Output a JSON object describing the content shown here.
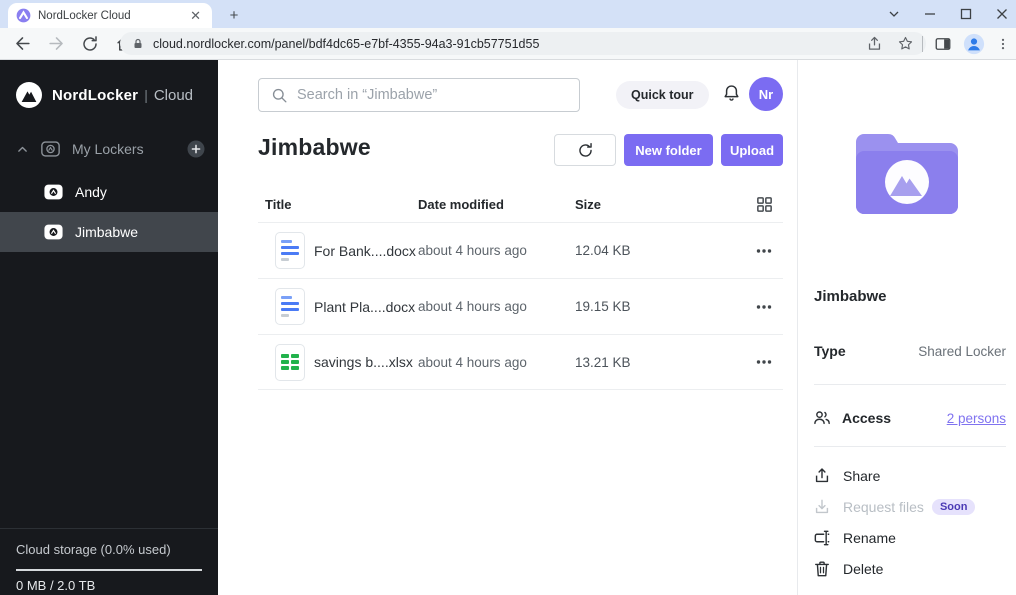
{
  "browser": {
    "tab_title": "NordLocker Cloud",
    "url": "cloud.nordlocker.com/panel/bdf4dc65-e7bf-4355-94a3-91cb57751d55"
  },
  "sidebar": {
    "brand": "NordLocker",
    "brand_divider": "|",
    "brand_suffix": "Cloud",
    "my_lockers_label": "My Lockers",
    "lockers": [
      {
        "name": "Andy"
      },
      {
        "name": "Jimbabwe"
      }
    ],
    "storage_label": "Cloud storage (0.0% used)",
    "storage_usage": "0 MB / 2.0 TB"
  },
  "header": {
    "search_placeholder": "Search in “Jimbabwe”",
    "quick_tour": "Quick tour",
    "avatar_initials": "Nr"
  },
  "content": {
    "title": "Jimbabwe",
    "new_folder": "New folder",
    "upload": "Upload",
    "columns": {
      "title": "Title",
      "date": "Date modified",
      "size": "Size"
    },
    "files": [
      {
        "name": "For Bank....docx",
        "type": "docx",
        "date": "about 4 hours ago",
        "size": "12.04 KB"
      },
      {
        "name": "Plant Pla....docx",
        "type": "docx",
        "date": "about 4 hours ago",
        "size": "19.15 KB"
      },
      {
        "name": "savings b....xlsx",
        "type": "xlsx",
        "date": "about 4 hours ago",
        "size": "13.21 KB"
      }
    ]
  },
  "details": {
    "name": "Jimbabwe",
    "type_label": "Type",
    "type_value": "Shared Locker",
    "access_label": "Access",
    "access_link": "2 persons",
    "share": "Share",
    "request_files": "Request files",
    "soon_badge": "Soon",
    "rename": "Rename",
    "delete": "Delete"
  },
  "colors": {
    "accent_purple": "#7b6cf2",
    "link_purple": "#8073f0",
    "sidebar_bg": "#17191d",
    "sidebar_selected": "#41464c",
    "soon_badge_bg": "#e6e2fc",
    "doc_icon_blue": "#4b7bf5",
    "sheet_icon_green": "#22b24c",
    "tabstrip_blue": "#d4e1f7"
  }
}
